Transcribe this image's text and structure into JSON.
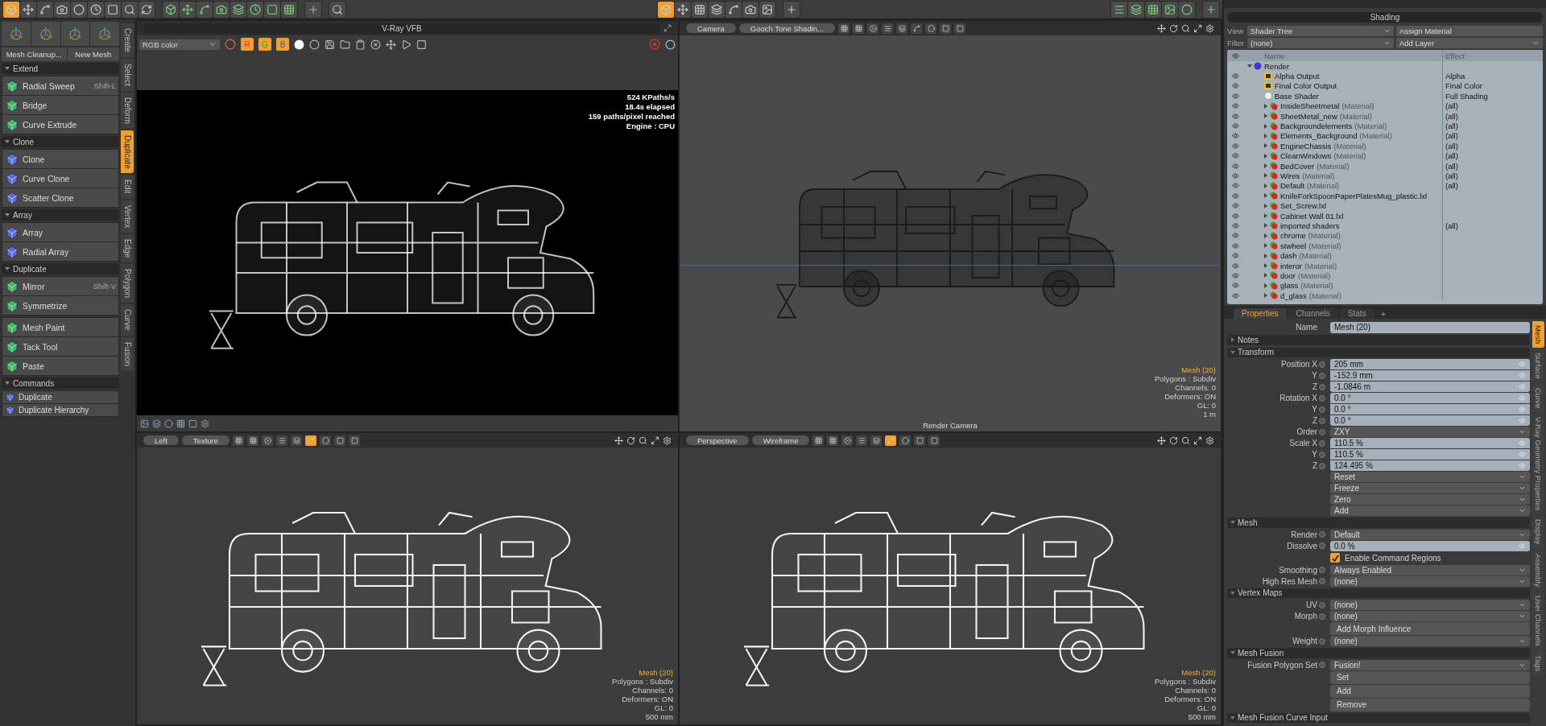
{
  "top_toolbar": {
    "mode_icons": [
      {
        "selected": true
      },
      {
        "selected": false
      },
      {
        "selected": false
      },
      {
        "selected": false
      },
      {
        "selected": false
      },
      {
        "selected": false
      },
      {
        "selected": false
      },
      {
        "selected": false
      },
      {
        "selected": false
      }
    ],
    "layout_icons": [
      {
        "selected": true
      },
      {
        "selected": false
      },
      {
        "selected": false
      },
      {
        "selected": false
      },
      {
        "selected": false
      },
      {
        "selected": false
      },
      {
        "selected": false
      }
    ]
  },
  "left_panel": {
    "actions": [
      "Mesh Cleanup...",
      "New Mesh"
    ],
    "sections": [
      {
        "title": "Extend",
        "kind": "tools",
        "items": [
          {
            "label": "Radial Sweep",
            "shortcut": "Shift-L"
          },
          {
            "label": "Bridge"
          },
          {
            "label": "Curve Extrude"
          }
        ]
      },
      {
        "title": "Clone",
        "kind": "tools",
        "items": [
          {
            "label": "Clone"
          },
          {
            "label": "Curve Clone"
          },
          {
            "label": "Scatter Clone"
          }
        ]
      },
      {
        "title": "Array",
        "kind": "tools",
        "items": [
          {
            "label": "Array"
          },
          {
            "label": "Radial Array"
          }
        ]
      },
      {
        "title": "Duplicate",
        "kind": "tools",
        "items": [
          {
            "label": "Mirror",
            "shortcut": "Shift-V"
          },
          {
            "label": "Symmetrize"
          }
        ]
      },
      {
        "kind": "tools",
        "items": [
          {
            "label": "Mesh Paint"
          },
          {
            "label": "Tack Tool"
          },
          {
            "label": "Paste"
          }
        ]
      },
      {
        "title": "Commands",
        "kind": "commands",
        "items": [
          {
            "label": "Duplicate"
          },
          {
            "label": "Duplicate Hierarchy"
          }
        ]
      }
    ],
    "tabs": [
      {
        "label": "Create",
        "selected": false
      },
      {
        "label": "Select",
        "selected": false
      },
      {
        "label": "Deform",
        "selected": false
      },
      {
        "label": "Duplicate",
        "selected": true
      },
      {
        "label": "Edit",
        "selected": false
      },
      {
        "label": "Vertex",
        "selected": false
      },
      {
        "label": "Edge",
        "selected": false
      },
      {
        "label": "Polygon",
        "selected": false
      },
      {
        "label": "Curve",
        "selected": false
      },
      {
        "label": "Fusion",
        "selected": false
      }
    ]
  },
  "viewports": [
    {
      "kind": "vfb",
      "title": "V-Ray VFB",
      "channel": "RGB color",
      "channel_buttons": [
        "R",
        "G",
        "B"
      ],
      "stats": [
        "524 KPaths/s",
        "18.4s elapsed",
        "159 paths/pixel reached",
        "Engine : CPU"
      ]
    },
    {
      "kind": "camera",
      "buttons": [
        "Camera",
        "Gooch Tone Shadin..."
      ],
      "info": [
        "Mesh (20)",
        "Polygons : Subdiv",
        "Channels: 0",
        "Deformers: ON",
        "GL: 0",
        "1 m"
      ],
      "footer": "Render Camera"
    },
    {
      "kind": "ortho",
      "buttons": [
        "Left",
        "Texture"
      ],
      "info": [
        "Mesh (20)",
        "Polygons : Subdiv",
        "Channels: 0",
        "Deformers: ON",
        "GL: 0",
        "500 mm"
      ]
    },
    {
      "kind": "perspective",
      "buttons": [
        "Perspective",
        "Wireframe"
      ],
      "info": [
        "Mesh (20)",
        "Polygons : Subdiv",
        "Channels: 0",
        "Deformers: ON",
        "GL: 0",
        "500 mm"
      ]
    }
  ],
  "shading": {
    "title": "Shading",
    "view_label": "View",
    "view": "Shader Tree",
    "assign": "Assign Material",
    "filter_label": "Filter",
    "filter": "(none)",
    "add_layer": "Add Layer",
    "columns": [
      "Name",
      "Effect"
    ],
    "tree": [
      {
        "name": "Render",
        "kind": "render",
        "expanded": true,
        "children": [
          {
            "name": "Alpha Output",
            "kind": "output",
            "effect": "Alpha"
          },
          {
            "name": "Final Color Output",
            "kind": "output",
            "effect": "Final Color"
          },
          {
            "name": "Base Shader",
            "kind": "shader",
            "effect": "Full Shading"
          },
          {
            "name": "InsideSheetmetal",
            "kind": "material",
            "type_label": "(Material)",
            "effect": "(all)",
            "expanded": false
          },
          {
            "name": "SheetMetal_new",
            "kind": "material",
            "type_label": "(Material)",
            "effect": "(all)",
            "expanded": false
          },
          {
            "name": "Backgroundelements",
            "kind": "material",
            "type_label": "(Material)",
            "effect": "(all)",
            "expanded": false
          },
          {
            "name": "Elements_Background",
            "kind": "material",
            "type_label": "(Material)",
            "effect": "(all)",
            "expanded": false
          },
          {
            "name": "EngineChassis",
            "kind": "material",
            "type_label": "(Material)",
            "effect": "(all)",
            "expanded": false
          },
          {
            "name": "CleanWindows",
            "kind": "material",
            "type_label": "(Material)",
            "effect": "(all)",
            "expanded": false
          },
          {
            "name": "BedCover",
            "kind": "material",
            "type_label": "(Material)",
            "effect": "(all)",
            "expanded": false
          },
          {
            "name": "Wires",
            "kind": "material",
            "type_label": "(Material)",
            "effect": "(all)",
            "expanded": false
          },
          {
            "name": "Default",
            "kind": "material",
            "type_label": "(Material)",
            "effect": "(all)",
            "expanded": false
          },
          {
            "name": "KnifeForkSpoonPaperPlatesMug_plastic.lxl",
            "kind": "material",
            "expanded": false
          },
          {
            "name": "Set_Screw.lxl",
            "kind": "material",
            "expanded": false
          },
          {
            "name": "Cabinet Wall 01.lxl",
            "kind": "material",
            "expanded": false
          },
          {
            "name": "imported shaders",
            "kind": "material",
            "effect": "(all)",
            "expanded": false
          },
          {
            "name": "chrome",
            "kind": "material",
            "type_label": "(Material)",
            "expanded": false
          },
          {
            "name": "stwheel",
            "kind": "material",
            "type_label": "(Material)",
            "expanded": false
          },
          {
            "name": "dash",
            "kind": "material",
            "type_label": "(Material)",
            "expanded": false
          },
          {
            "name": "interor",
            "kind": "material",
            "type_label": "(Material)",
            "expanded": false
          },
          {
            "name": "door",
            "kind": "material",
            "type_label": "(Material)",
            "expanded": false
          },
          {
            "name": "glass",
            "kind": "material",
            "type_label": "(Material)",
            "expanded": false
          },
          {
            "name": "d_glass",
            "kind": "material",
            "type_label": "(Material)",
            "expanded": false
          }
        ]
      }
    ]
  },
  "properties": {
    "tabs": [
      {
        "label": "Properties",
        "selected": true
      },
      {
        "label": "Channels",
        "selected": false
      },
      {
        "label": "Stats",
        "selected": false
      }
    ],
    "add_tab": "+",
    "name_label": "Name",
    "name": "Mesh (20)",
    "sections": [
      {
        "title": "Notes",
        "expanded": false
      },
      {
        "title": "Transform",
        "expanded": true,
        "rows": [
          {
            "kind": "vector",
            "fields": [
              {
                "label": "Position X",
                "value": "205 mm"
              },
              {
                "label": "Y",
                "value": "-152.9 mm"
              },
              {
                "label": "Z",
                "value": "-1.0846 m"
              }
            ]
          },
          {
            "kind": "vector",
            "fields": [
              {
                "label": "Rotation X",
                "value": "0.0 °"
              },
              {
                "label": "Y",
                "value": "0.0 °"
              },
              {
                "label": "Z",
                "value": "0.0 °"
              }
            ]
          },
          {
            "kind": "dropdown",
            "label": "Order",
            "value": "ZXY"
          },
          {
            "kind": "vector",
            "fields": [
              {
                "label": "Scale X",
                "value": "110.5 %"
              },
              {
                "label": "Y",
                "value": "110.5 %"
              },
              {
                "label": "Z",
                "value": "124.495 %"
              }
            ]
          },
          {
            "kind": "dropdown",
            "value": "Reset"
          },
          {
            "kind": "dropdown",
            "value": "Freeze"
          },
          {
            "kind": "dropdown",
            "value": "Zero"
          },
          {
            "kind": "dropdown",
            "value": "Add"
          }
        ]
      },
      {
        "title": "Mesh",
        "expanded": true,
        "rows": [
          {
            "kind": "dropdown",
            "label": "Render",
            "value": "Default"
          },
          {
            "kind": "field",
            "label": "Dissolve",
            "value": "0.0 %"
          },
          {
            "kind": "checkbox",
            "value": "Enable Command Regions",
            "checked": true
          },
          {
            "kind": "dropdown",
            "label": "Smoothing",
            "value": "Always Enabled"
          },
          {
            "kind": "dropdown",
            "label": "High Res Mesh",
            "value": "(none)"
          }
        ]
      },
      {
        "title": "Vertex Maps",
        "expanded": true,
        "rows": [
          {
            "kind": "dropdown",
            "label": "UV",
            "value": "(none)"
          },
          {
            "kind": "dropdown",
            "label": "Morph",
            "value": "(none)"
          },
          {
            "kind": "button",
            "value": "Add Morph Influence"
          },
          {
            "kind": "dropdown",
            "label": "Weight",
            "value": "(none)"
          }
        ]
      },
      {
        "title": "Mesh Fusion",
        "expanded": true,
        "rows": [
          {
            "kind": "dropdown",
            "label": "Fusion Polygon Set",
            "value": "Fusion!"
          },
          {
            "kind": "button",
            "value": "Set"
          },
          {
            "kind": "button",
            "value": "Add"
          },
          {
            "kind": "button",
            "value": "Remove"
          }
        ]
      },
      {
        "title": "Mesh Fusion Curve Input",
        "expanded": true
      }
    ],
    "side_tabs": [
      {
        "label": "Mesh",
        "selected": true
      },
      {
        "label": "Surface",
        "selected": false
      },
      {
        "label": "Curve",
        "selected": false
      },
      {
        "label": "V-Ray Geometry Properties",
        "selected": false
      },
      {
        "label": "Display",
        "selected": false
      },
      {
        "label": "Assembly",
        "selected": false
      },
      {
        "label": "User Channels",
        "selected": false
      },
      {
        "label": "Tags",
        "selected": false
      }
    ]
  }
}
